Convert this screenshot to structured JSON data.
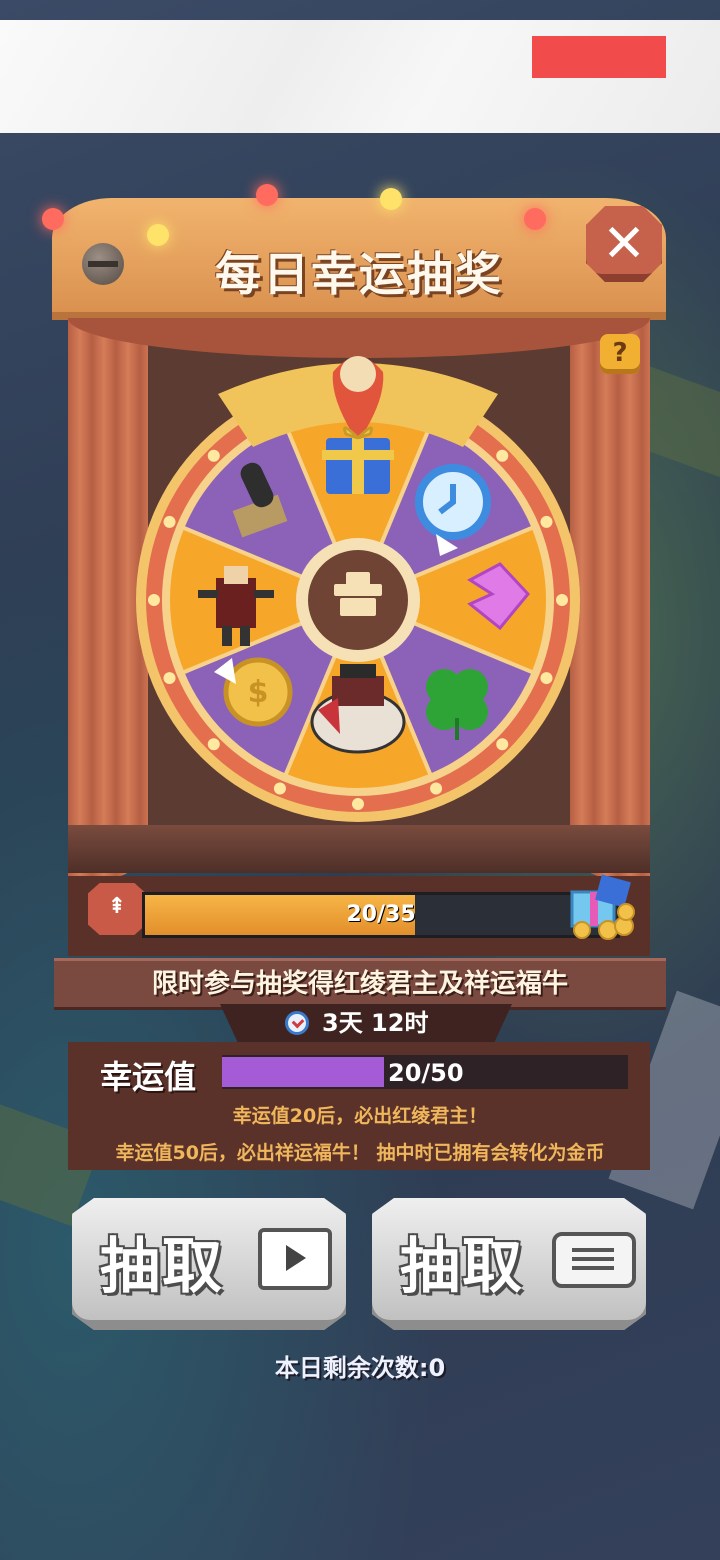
{
  "title": "每日幸运抽奖",
  "close_label": "✕",
  "help_label": "?",
  "progress": {
    "current": 20,
    "max": 35,
    "text": "20/35",
    "up_label": "⇞"
  },
  "event_banner": "限时参与抽奖得红绫君主及祥运福牛",
  "timer": "3天 12时",
  "luck": {
    "label": "幸运值",
    "current": 20,
    "max": 50,
    "text": "20/50",
    "note1": "幸运值20后，必出红绫君主！",
    "note2": "幸运值50后，必出祥运福牛！ 抽中时已拥有会转化为金币"
  },
  "buttons": {
    "draw_video_label": "抽取",
    "draw_ticket_label": "抽取"
  },
  "remaining": "本日剩余次数:0",
  "wheel_items": [
    {
      "name": "gift-box-icon"
    },
    {
      "name": "time-refresh-icon"
    },
    {
      "name": "pink-gem-icon"
    },
    {
      "name": "four-leaf-clover-icon"
    },
    {
      "name": "bull-rider-icon"
    },
    {
      "name": "gold-coin-icon"
    },
    {
      "name": "warrior-figure-icon"
    },
    {
      "name": "cannon-icon"
    }
  ],
  "colors": {
    "sign": "#e8a25c",
    "wood": "#5b3229",
    "orange_slice": "#f6a72a",
    "purple_slice": "#8c62b8",
    "wheel_rim": "#e36f4e",
    "luck_bar": "#a55ad6",
    "progress_bar": "#f0a23c"
  }
}
